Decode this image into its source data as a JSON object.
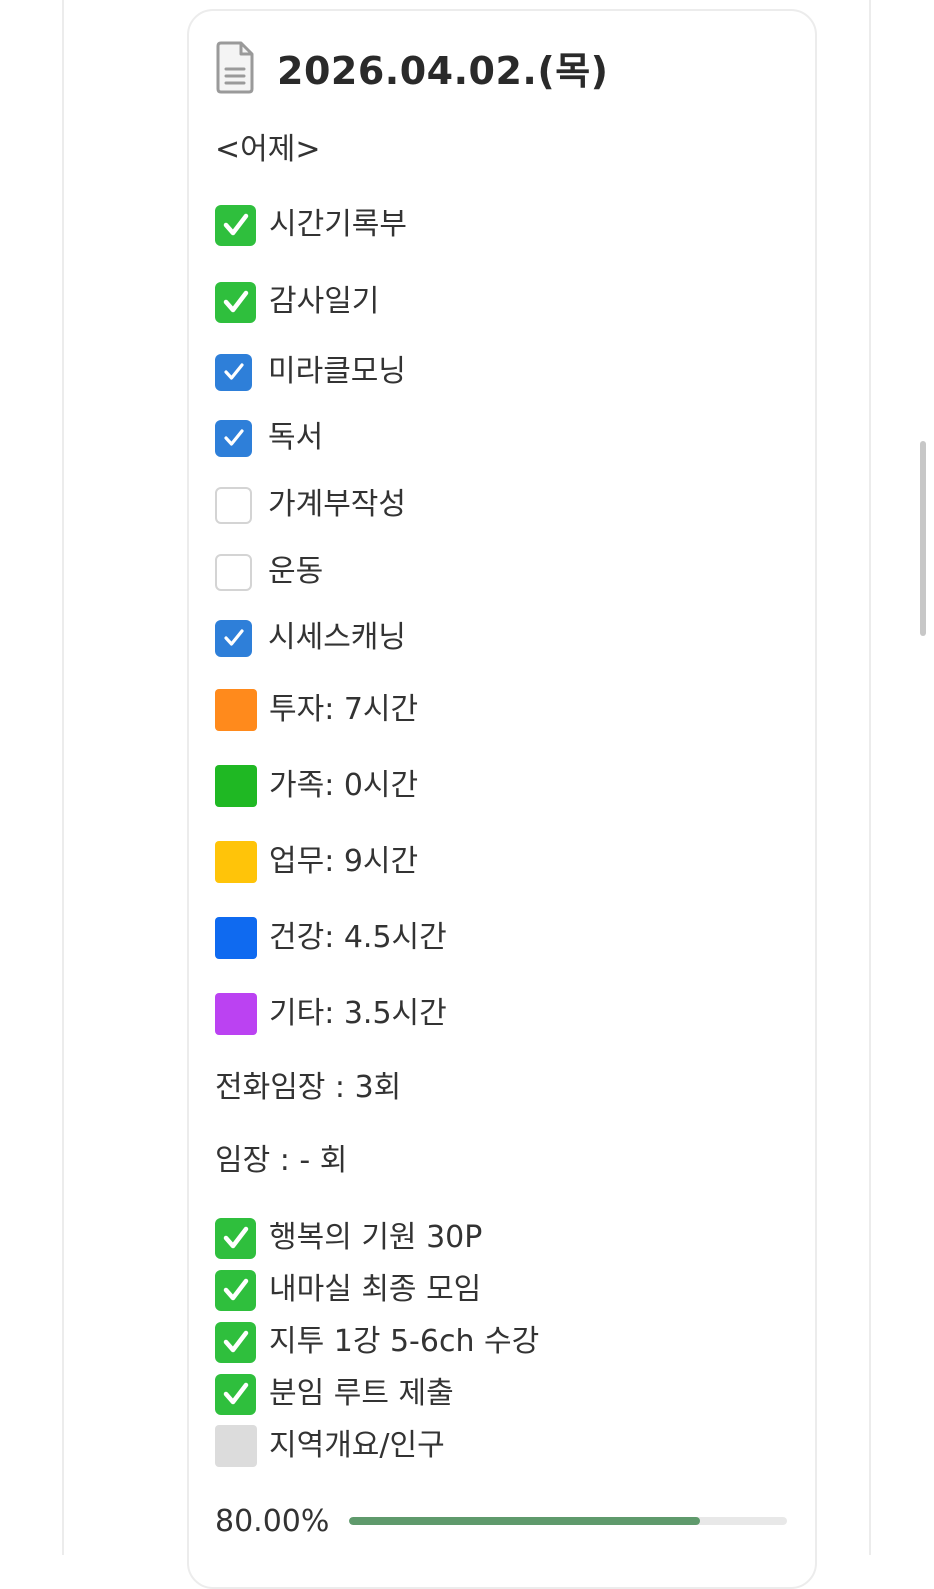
{
  "page": {
    "title": "2026.04.02.(목)",
    "section_label": "<어제>"
  },
  "checklist": [
    {
      "style": "emoji-check",
      "label": "시간기록부"
    },
    {
      "style": "emoji-check",
      "label": "감사일기"
    },
    {
      "style": "checkbox-checked",
      "label": "미라클모닝"
    },
    {
      "style": "checkbox-checked",
      "label": "독서"
    },
    {
      "style": "checkbox-unchecked",
      "label": "가계부작성"
    },
    {
      "style": "checkbox-unchecked",
      "label": "운동"
    },
    {
      "style": "checkbox-checked",
      "label": "시세스캐닝"
    }
  ],
  "time_log": [
    {
      "color": "#ff8a1c",
      "label": "투자: 7시간"
    },
    {
      "color": "#1fb823",
      "label": "가족: 0시간"
    },
    {
      "color": "#ffc409",
      "label": "업무: 9시간"
    },
    {
      "color": "#0f6af0",
      "label": "건강: 4.5시간"
    },
    {
      "color": "#bb42f2",
      "label": "기타: 3.5시간"
    }
  ],
  "counts": {
    "phone_visit": "전화임장 : 3회",
    "visit": "임장 : - 회"
  },
  "tasks": [
    {
      "style": "emoji-check",
      "label": "행복의 기원 30P"
    },
    {
      "style": "emoji-check",
      "label": "내마실 최종 모임"
    },
    {
      "style": "emoji-check",
      "label": "지투 1강 5-6ch 수강"
    },
    {
      "style": "emoji-check",
      "label": "분임 루트 제출"
    },
    {
      "style": "gray-square",
      "label": "지역개요/인구"
    }
  ],
  "progress": {
    "label": "80.00%",
    "fraction": 0.8
  }
}
